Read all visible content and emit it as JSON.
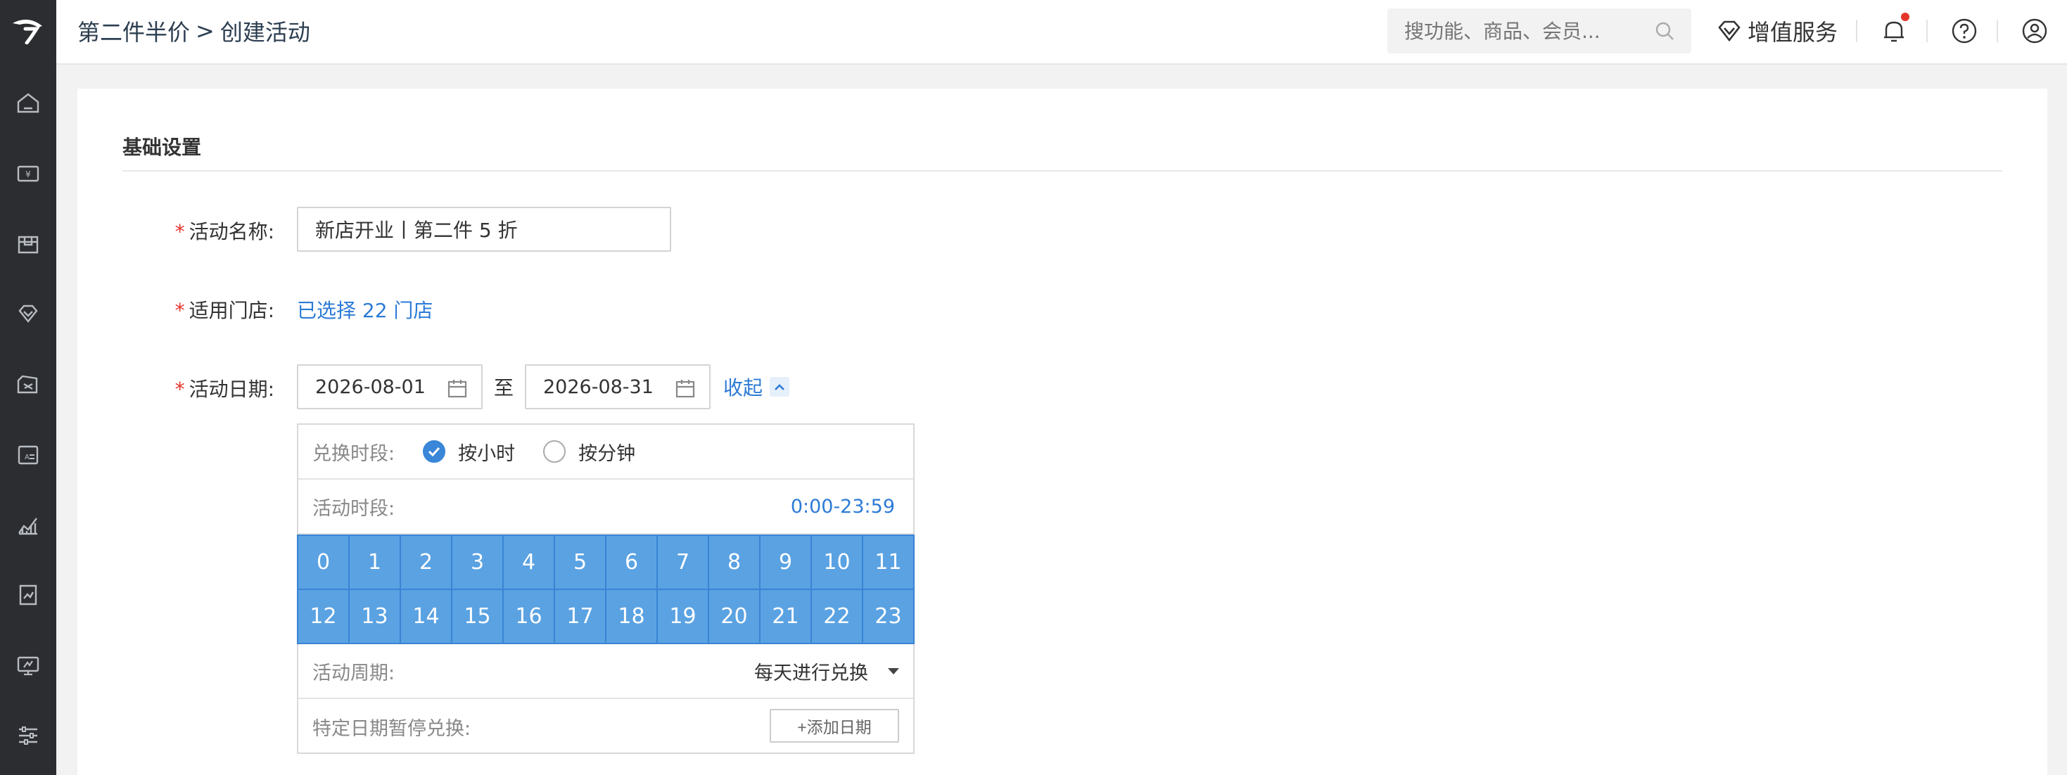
{
  "breadcrumb": {
    "parent": "第二件半价",
    "separator": ">",
    "current": "创建活动"
  },
  "search": {
    "placeholder": "搜功能、商品、会员..."
  },
  "header": {
    "value_added_services": "增值服务"
  },
  "section": {
    "title": "基础设置"
  },
  "form": {
    "required_mark": "*",
    "name_label": "活动名称:",
    "name_value": "新店开业丨第二件 5 折",
    "store_label": "适用门店:",
    "store_link": "已选择 22 门店",
    "date_label": "活动日期:",
    "start_date": "2026-08-01",
    "to_text": "至",
    "end_date": "2026-08-31",
    "collapse_label": "收起"
  },
  "time_panel": {
    "exchange_period_label": "兑换时段:",
    "option_by_hour": "按小时",
    "option_by_minute": "按分钟",
    "selected_option": "按小时",
    "active_period_label": "活动时段:",
    "active_period_value": "0:00-23:59",
    "hours_row1": [
      "0",
      "1",
      "2",
      "3",
      "4",
      "5",
      "6",
      "7",
      "8",
      "9",
      "10",
      "11"
    ],
    "hours_row2": [
      "12",
      "13",
      "14",
      "15",
      "16",
      "17",
      "18",
      "19",
      "20",
      "21",
      "22",
      "23"
    ],
    "cycle_label": "活动周期:",
    "cycle_value": "每天进行兑换",
    "pause_label": "特定日期暂停兑换:",
    "add_date_button": "+添加日期"
  },
  "colors": {
    "accent": "#2d7bd6",
    "hour_fill": "#5aa2e2",
    "sidebar": "#2b2d30",
    "required": "#e5352b"
  }
}
